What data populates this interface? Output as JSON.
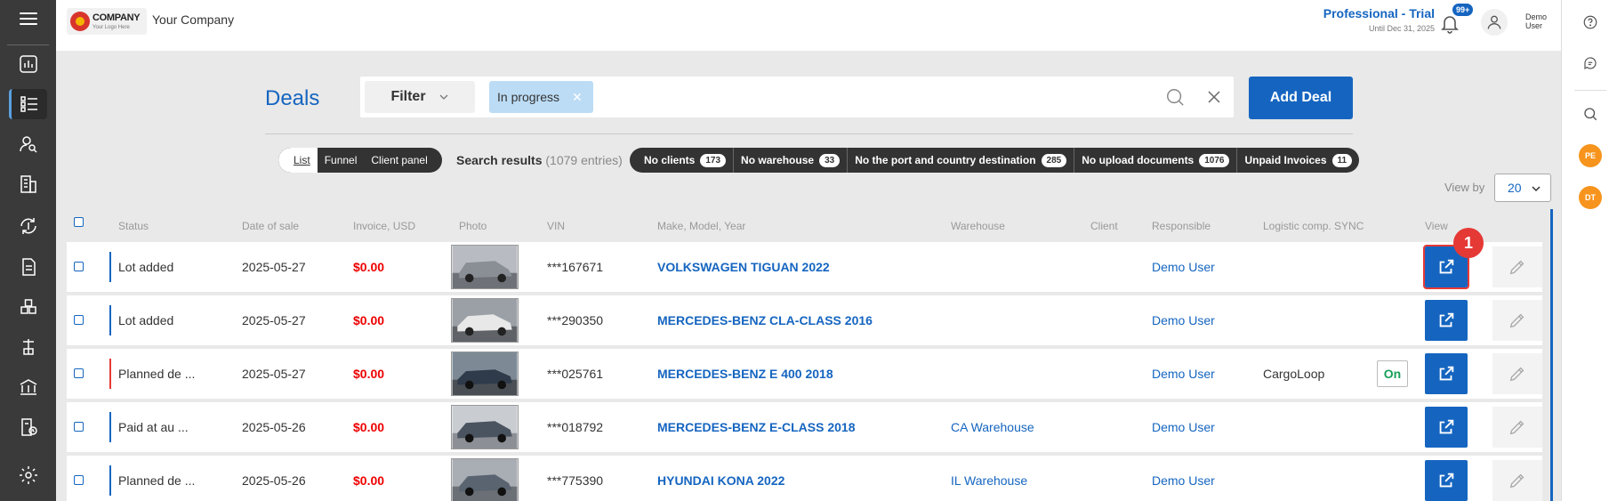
{
  "header": {
    "logo_text": "COMPANY",
    "logo_tagline": "Your Logo Here",
    "company_name": "Your Company",
    "plan_title": "Professional - Trial",
    "plan_subtitle": "Until Dec 31, 2025",
    "notifications_badge": "99+",
    "user_name_line1": "Demo",
    "user_name_line2": "User"
  },
  "page": {
    "title": "Deals",
    "filter_label": "Filter",
    "active_tag": "In progress",
    "add_button": "Add Deal"
  },
  "view_switch": [
    "List",
    "Funnel",
    "Client panel"
  ],
  "results": {
    "label": "Search results",
    "count": "(1079 entries)"
  },
  "chips": [
    {
      "label": "No clients",
      "count": "173"
    },
    {
      "label": "No warehouse",
      "count": "33"
    },
    {
      "label": "No the port and country destination",
      "count": "285"
    },
    {
      "label": "No upload documents",
      "count": "1076"
    },
    {
      "label": "Unpaid Invoices",
      "count": "11"
    }
  ],
  "view_by": {
    "label": "View by",
    "value": "20"
  },
  "columns": [
    "Status",
    "Date of sale",
    "Invoice, USD",
    "Photo",
    "VIN",
    "Make, Model, Year",
    "Warehouse",
    "Client",
    "Responsible",
    "Logistic comp. SYNC",
    "View"
  ],
  "rows": [
    {
      "status": "Lot added",
      "date": "2025-05-27",
      "invoice": "$0.00",
      "vin": "***167671",
      "model": "VOLKSWAGEN TIGUAN 2022",
      "warehouse": "",
      "client": "",
      "responsible": "Demo User",
      "logistic": "",
      "sync": "",
      "marker": "blue",
      "photo_color": "#8a8f96"
    },
    {
      "status": "Lot added",
      "date": "2025-05-27",
      "invoice": "$0.00",
      "vin": "***290350",
      "model": "MERCEDES-BENZ CLA-CLASS 2016",
      "warehouse": "",
      "client": "",
      "responsible": "Demo User",
      "logistic": "",
      "sync": "",
      "marker": "blue",
      "photo_color": "#d9d9d9"
    },
    {
      "status": "Planned de ...",
      "date": "2025-05-27",
      "invoice": "$0.00",
      "vin": "***025761",
      "model": "MERCEDES-BENZ E 400 2018",
      "warehouse": "",
      "client": "",
      "responsible": "Demo User",
      "logistic": "CargoLoop",
      "sync": "On",
      "marker": "red",
      "photo_color": "#3c4a5a"
    },
    {
      "status": "Paid at au ...",
      "date": "2025-05-26",
      "invoice": "$0.00",
      "vin": "***018792",
      "model": "MERCEDES-BENZ E-CLASS 2018",
      "warehouse": "CA Warehouse",
      "client": "",
      "responsible": "Demo User",
      "logistic": "",
      "sync": "",
      "marker": "blue",
      "photo_color": "#4a5360"
    },
    {
      "status": "Planned de ...",
      "date": "2025-05-26",
      "invoice": "$0.00",
      "vin": "***775390",
      "model": "HYUNDAI KONA 2022",
      "warehouse": "IL Warehouse",
      "client": "",
      "responsible": "Demo User",
      "logistic": "",
      "sync": "",
      "marker": "blue",
      "photo_color": "#5a6470"
    }
  ],
  "annotation": {
    "step": "1"
  },
  "right_sidebar": {
    "avatar1": "PE",
    "avatar2": "DT"
  },
  "colors": {
    "accent": "#1565c0",
    "danger": "#e53935",
    "sidebar": "#3a3a3a"
  }
}
